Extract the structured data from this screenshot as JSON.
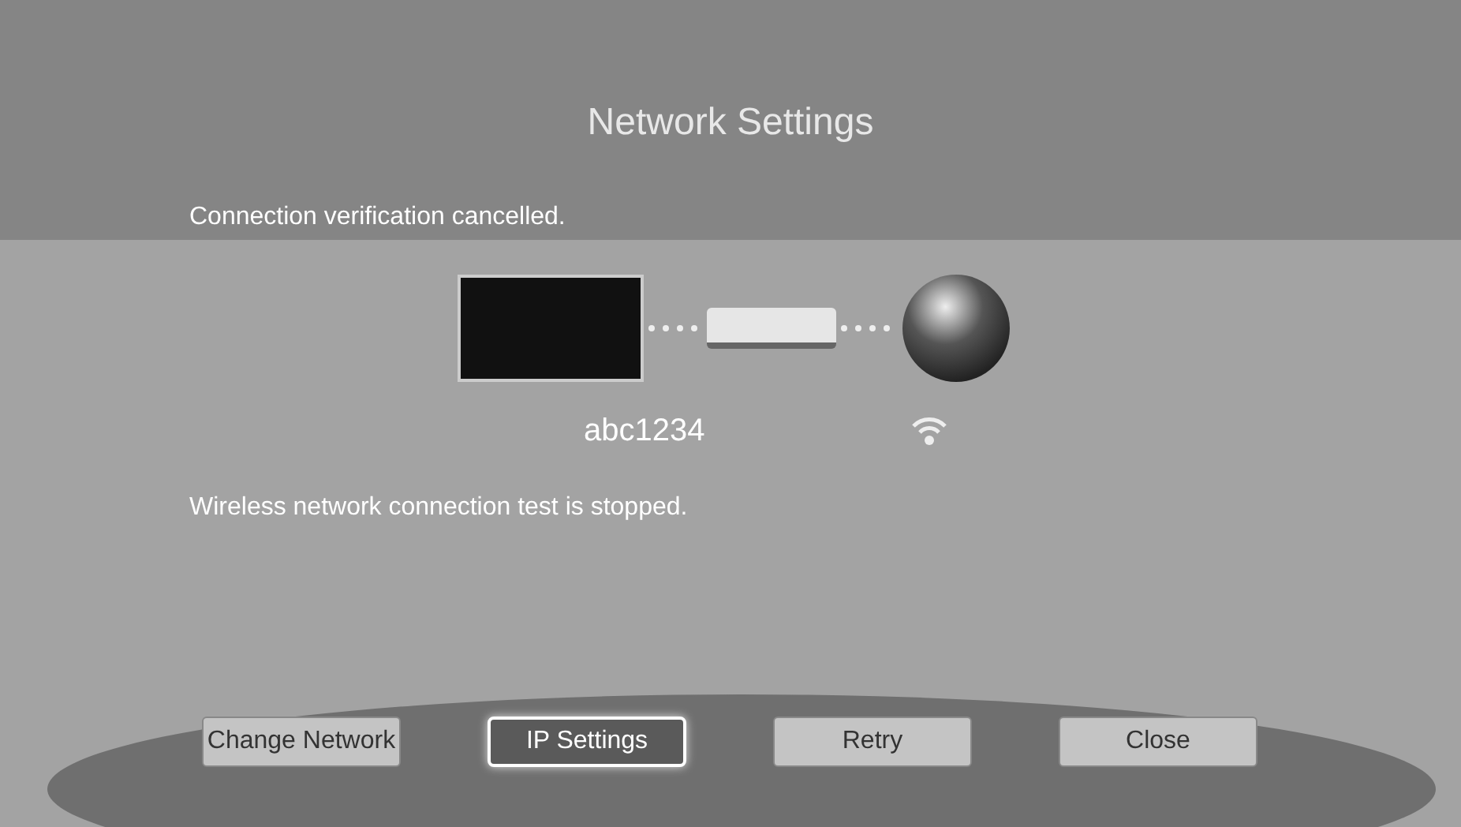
{
  "window": {
    "title": "Network Settings"
  },
  "status_message": "Connection verification cancelled.",
  "network": {
    "name": "abc1234"
  },
  "result_message": "Wireless network connection test is stopped.",
  "buttons": [
    {
      "label": "Change Network",
      "selected": false
    },
    {
      "label": "IP Settings",
      "selected": true
    },
    {
      "label": "Retry",
      "selected": false
    },
    {
      "label": "Close",
      "selected": false
    }
  ]
}
